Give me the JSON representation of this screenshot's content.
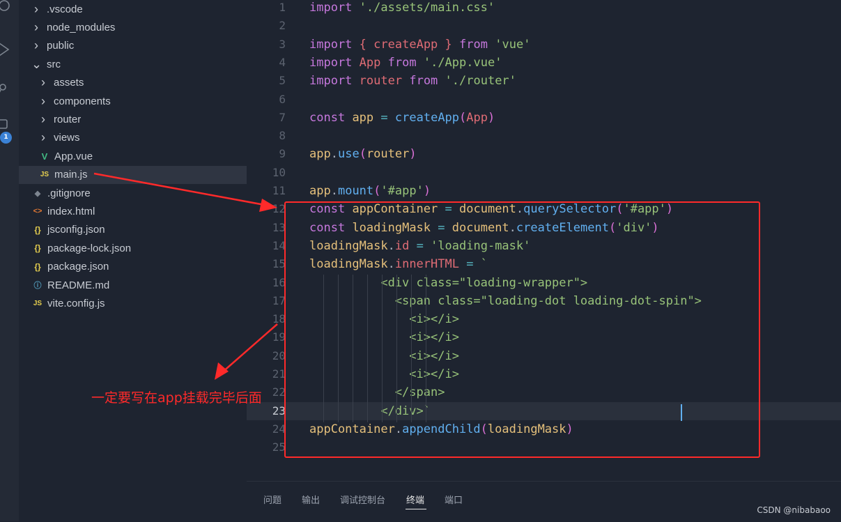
{
  "activity_bar": {
    "badge": "1",
    "icons": [
      "search-icon",
      "run-icon",
      "source-control-icon",
      "extensions-icon"
    ]
  },
  "explorer": {
    "items": [
      {
        "label": ".vscode",
        "kind": "folder",
        "expanded": false,
        "depth": 0
      },
      {
        "label": "node_modules",
        "kind": "folder",
        "expanded": false,
        "depth": 0
      },
      {
        "label": "public",
        "kind": "folder",
        "expanded": false,
        "depth": 0
      },
      {
        "label": "src",
        "kind": "folder",
        "expanded": true,
        "depth": 0
      },
      {
        "label": "assets",
        "kind": "folder",
        "expanded": false,
        "depth": 1
      },
      {
        "label": "components",
        "kind": "folder",
        "expanded": false,
        "depth": 1
      },
      {
        "label": "router",
        "kind": "folder",
        "expanded": false,
        "depth": 1
      },
      {
        "label": "views",
        "kind": "folder",
        "expanded": false,
        "depth": 1
      },
      {
        "label": "App.vue",
        "kind": "vue",
        "depth": 1,
        "icon_text": "V"
      },
      {
        "label": "main.js",
        "kind": "js",
        "depth": 1,
        "icon_text": "JS",
        "selected": true
      },
      {
        "label": ".gitignore",
        "kind": "git",
        "depth": 0,
        "icon_text": "◆"
      },
      {
        "label": "index.html",
        "kind": "html",
        "depth": 0,
        "icon_text": "<>"
      },
      {
        "label": "jsconfig.json",
        "kind": "json",
        "depth": 0,
        "icon_text": "{}"
      },
      {
        "label": "package-lock.json",
        "kind": "json",
        "depth": 0,
        "icon_text": "{}"
      },
      {
        "label": "package.json",
        "kind": "json",
        "depth": 0,
        "icon_text": "{}"
      },
      {
        "label": "README.md",
        "kind": "info",
        "depth": 0,
        "icon_text": "ⓘ"
      },
      {
        "label": "vite.config.js",
        "kind": "js",
        "depth": 0,
        "icon_text": "JS"
      }
    ]
  },
  "editor": {
    "current_line": 23,
    "lines": [
      {
        "n": "1",
        "tokens": [
          [
            "kw",
            "import"
          ],
          [
            "p",
            " "
          ],
          [
            "str",
            "'./assets/main.css'"
          ]
        ]
      },
      {
        "n": "2",
        "tokens": []
      },
      {
        "n": "3",
        "tokens": [
          [
            "kw",
            "import"
          ],
          [
            "p",
            " "
          ],
          [
            "prop",
            "{"
          ],
          [
            "p",
            " "
          ],
          [
            "prop",
            "createApp"
          ],
          [
            "p",
            " "
          ],
          [
            "prop",
            "}"
          ],
          [
            "p",
            " "
          ],
          [
            "kw",
            "from"
          ],
          [
            "p",
            " "
          ],
          [
            "str",
            "'vue'"
          ]
        ]
      },
      {
        "n": "4",
        "tokens": [
          [
            "kw",
            "import"
          ],
          [
            "p",
            " "
          ],
          [
            "prop",
            "App"
          ],
          [
            "p",
            " "
          ],
          [
            "kw",
            "from"
          ],
          [
            "p",
            " "
          ],
          [
            "str",
            "'./App.vue'"
          ]
        ]
      },
      {
        "n": "5",
        "tokens": [
          [
            "kw",
            "import"
          ],
          [
            "p",
            " "
          ],
          [
            "prop",
            "router"
          ],
          [
            "p",
            " "
          ],
          [
            "kw",
            "from"
          ],
          [
            "p",
            " "
          ],
          [
            "str",
            "'./router'"
          ]
        ]
      },
      {
        "n": "6",
        "tokens": []
      },
      {
        "n": "7",
        "tokens": [
          [
            "kw",
            "const"
          ],
          [
            "p",
            " "
          ],
          [
            "var",
            "app"
          ],
          [
            "p",
            " "
          ],
          [
            "op",
            "="
          ],
          [
            "p",
            " "
          ],
          [
            "fn",
            "createApp"
          ],
          [
            "paren",
            "("
          ],
          [
            "prop",
            "App"
          ],
          [
            "paren",
            ")"
          ]
        ]
      },
      {
        "n": "8",
        "tokens": []
      },
      {
        "n": "9",
        "tokens": [
          [
            "var",
            "app"
          ],
          [
            "p",
            "."
          ],
          [
            "fn",
            "use"
          ],
          [
            "paren",
            "("
          ],
          [
            "var",
            "router"
          ],
          [
            "paren",
            ")"
          ]
        ]
      },
      {
        "n": "10",
        "tokens": []
      },
      {
        "n": "11",
        "tokens": [
          [
            "var",
            "app"
          ],
          [
            "p",
            "."
          ],
          [
            "fn",
            "mount"
          ],
          [
            "paren",
            "("
          ],
          [
            "str",
            "'#app'"
          ],
          [
            "paren",
            ")"
          ]
        ]
      },
      {
        "n": "12",
        "tokens": [
          [
            "kw",
            "const"
          ],
          [
            "p",
            " "
          ],
          [
            "var",
            "appContainer"
          ],
          [
            "p",
            " "
          ],
          [
            "op",
            "="
          ],
          [
            "p",
            " "
          ],
          [
            "var",
            "document"
          ],
          [
            "p",
            "."
          ],
          [
            "fn",
            "querySelector"
          ],
          [
            "paren",
            "("
          ],
          [
            "str",
            "'#app'"
          ],
          [
            "paren",
            ")"
          ]
        ]
      },
      {
        "n": "13",
        "tokens": [
          [
            "kw",
            "const"
          ],
          [
            "p",
            " "
          ],
          [
            "var",
            "loadingMask"
          ],
          [
            "p",
            " "
          ],
          [
            "op",
            "="
          ],
          [
            "p",
            " "
          ],
          [
            "var",
            "document"
          ],
          [
            "p",
            "."
          ],
          [
            "fn",
            "createElement"
          ],
          [
            "paren",
            "("
          ],
          [
            "str",
            "'div'"
          ],
          [
            "paren",
            ")"
          ]
        ]
      },
      {
        "n": "14",
        "tokens": [
          [
            "var",
            "loadingMask"
          ],
          [
            "p",
            "."
          ],
          [
            "prop",
            "id"
          ],
          [
            "p",
            " "
          ],
          [
            "op",
            "="
          ],
          [
            "p",
            " "
          ],
          [
            "str",
            "'loading-mask'"
          ]
        ]
      },
      {
        "n": "15",
        "tokens": [
          [
            "var",
            "loadingMask"
          ],
          [
            "p",
            "."
          ],
          [
            "prop",
            "innerHTML"
          ],
          [
            "p",
            " "
          ],
          [
            "op",
            "="
          ],
          [
            "p",
            " "
          ],
          [
            "str",
            "`"
          ]
        ]
      },
      {
        "n": "16",
        "tokens": [
          [
            "str",
            "          <div class=\"loading-wrapper\">"
          ]
        ]
      },
      {
        "n": "17",
        "tokens": [
          [
            "str",
            "            <span class=\"loading-dot loading-dot-spin\">"
          ]
        ]
      },
      {
        "n": "18",
        "tokens": [
          [
            "str",
            "              <i></i>"
          ]
        ]
      },
      {
        "n": "19",
        "tokens": [
          [
            "str",
            "              <i></i>"
          ]
        ]
      },
      {
        "n": "20",
        "tokens": [
          [
            "str",
            "              <i></i>"
          ]
        ]
      },
      {
        "n": "21",
        "tokens": [
          [
            "str",
            "              <i></i>"
          ]
        ]
      },
      {
        "n": "22",
        "tokens": [
          [
            "str",
            "            </span>"
          ]
        ]
      },
      {
        "n": "23",
        "tokens": [
          [
            "str",
            "          </div>`"
          ]
        ]
      },
      {
        "n": "24",
        "tokens": [
          [
            "var",
            "appContainer"
          ],
          [
            "p",
            "."
          ],
          [
            "fn",
            "appendChild"
          ],
          [
            "paren",
            "("
          ],
          [
            "var",
            "loadingMask"
          ],
          [
            "paren",
            ")"
          ]
        ]
      },
      {
        "n": "25",
        "tokens": []
      }
    ]
  },
  "annotation": {
    "text": "一定要写在app挂载完毕后面"
  },
  "panel": {
    "tabs": [
      {
        "label": "问题",
        "active": false
      },
      {
        "label": "输出",
        "active": false
      },
      {
        "label": "调试控制台",
        "active": false
      },
      {
        "label": "终端",
        "active": true
      },
      {
        "label": "端口",
        "active": false
      }
    ]
  },
  "watermark": "CSDN @nibabaoo",
  "colors": {
    "background": "#1e2430",
    "annotation_red": "#ff2a2a",
    "keyword": "#c678dd",
    "variable": "#e5c07b",
    "string": "#98c379",
    "function": "#61afef",
    "property": "#e06c75"
  }
}
